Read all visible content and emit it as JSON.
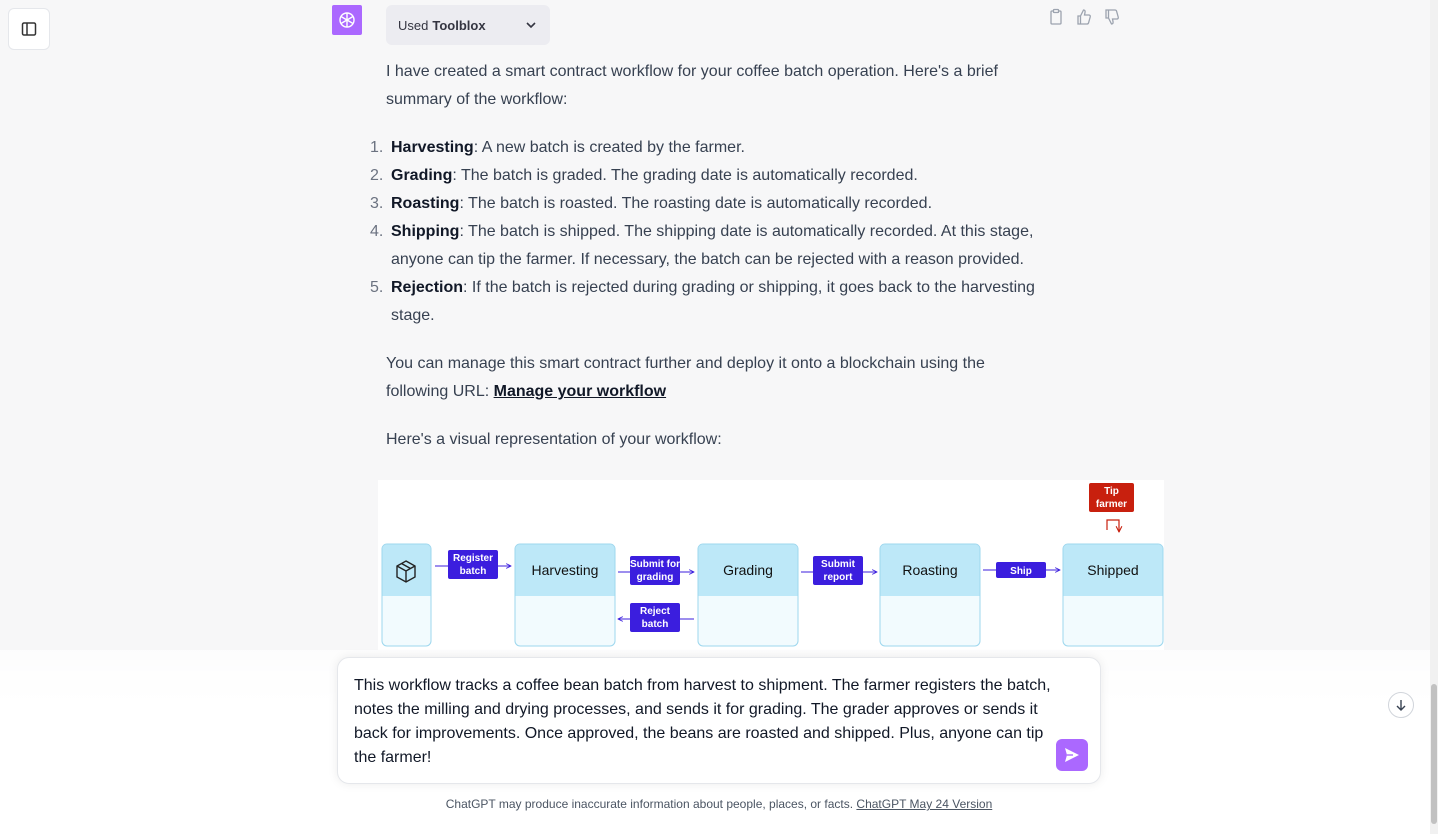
{
  "tool": {
    "prefix": "Used",
    "name": "Toolblox"
  },
  "message": {
    "intro": "I have created a smart contract workflow for your coffee batch operation. Here's a brief summary of the workflow:",
    "steps": [
      {
        "num": "1.",
        "title": "Harvesting",
        "text": ": A new batch is created by the farmer."
      },
      {
        "num": "2.",
        "title": "Grading",
        "text": ": The batch is graded. The grading date is automatically recorded."
      },
      {
        "num": "3.",
        "title": "Roasting",
        "text": ": The batch is roasted. The roasting date is automatically recorded."
      },
      {
        "num": "4.",
        "title": "Shipping",
        "text": ": The batch is shipped. The shipping date is automatically recorded. At this stage, anyone can tip the farmer. If necessary, the batch can be rejected with a reason provided."
      },
      {
        "num": "5.",
        "title": "Rejection",
        "text": ": If the batch is rejected during grading or shipping, it goes back to the harvesting stage."
      }
    ],
    "manage_text": "You can manage this smart contract further and deploy it onto a blockchain using the following URL: ",
    "manage_link": "Manage your workflow",
    "visual_text": "Here's a visual representation of your workflow:"
  },
  "diagram": {
    "states": [
      "Harvesting",
      "Grading",
      "Roasting",
      "Shipped"
    ],
    "actions": {
      "register": [
        "Register",
        "batch"
      ],
      "submit_grading": [
        "Submit for",
        "grading"
      ],
      "submit_report": [
        "Submit",
        "report"
      ],
      "ship": "Ship",
      "reject": [
        "Reject",
        "batch"
      ],
      "tip": [
        "Tip",
        "farmer"
      ]
    },
    "colors": {
      "state_header": "#bde8f8",
      "state_body": "#f2fbfe",
      "action": "#3b1ede",
      "tip": "#c8200e"
    }
  },
  "composer": {
    "text": "This workflow tracks a coffee bean batch from harvest to shipment. The farmer registers the batch, notes the milling and drying processes, and sends it for grading. The grader approves or sends it back for improvements. Once approved, the beans are roasted and shipped. Plus, anyone can tip the farmer!"
  },
  "footer": {
    "text": "ChatGPT may produce inaccurate information about people, places, or facts. ",
    "link": "ChatGPT May 24 Version"
  },
  "colors": {
    "accent": "#ab68ff",
    "background": "#f7f7f8"
  }
}
